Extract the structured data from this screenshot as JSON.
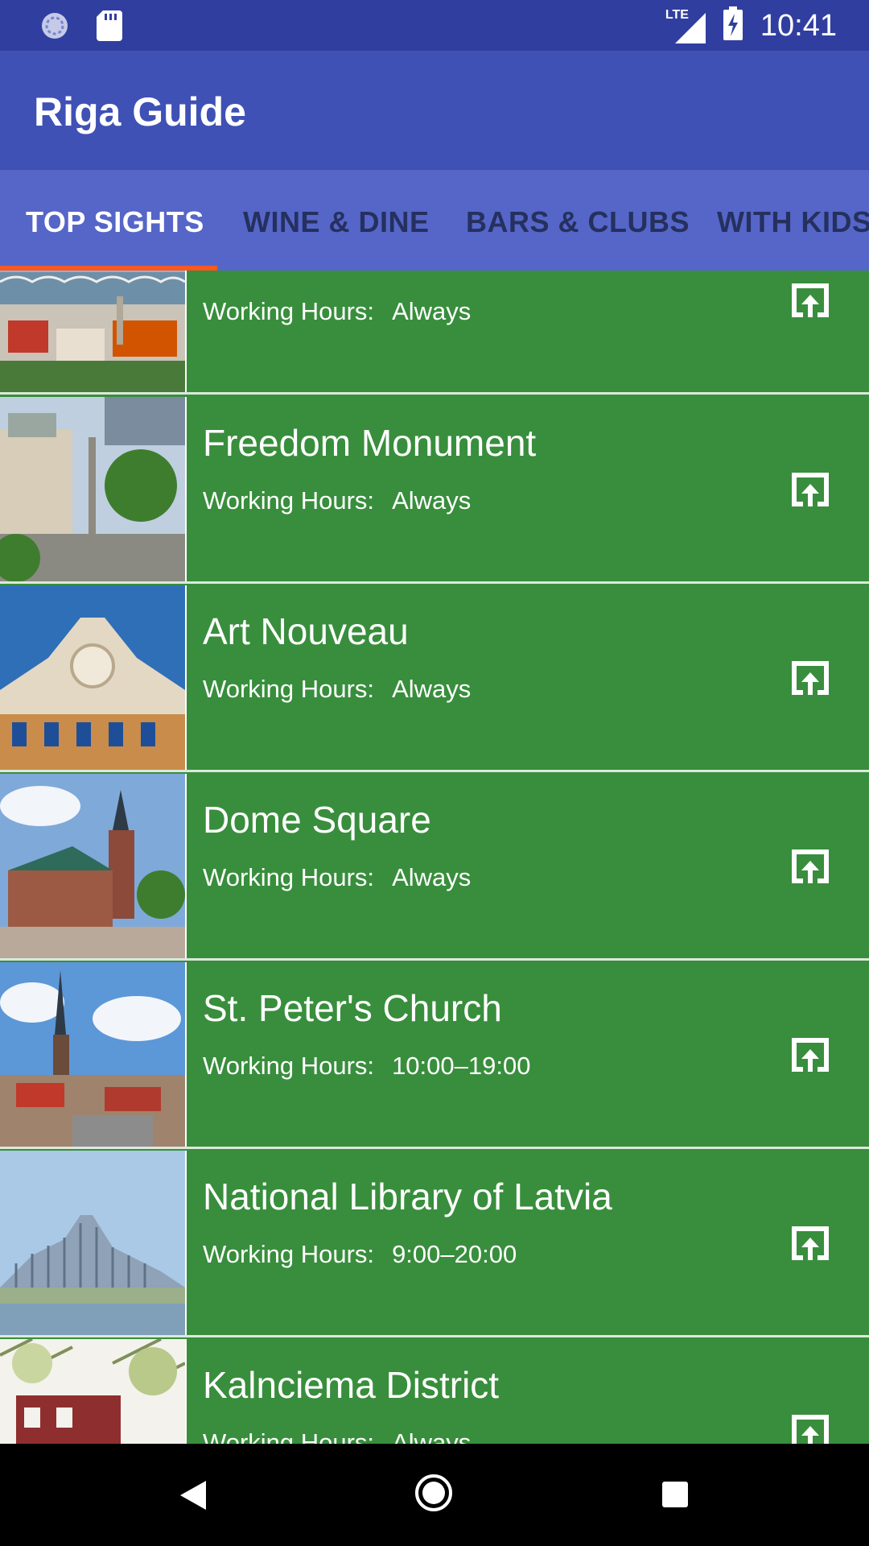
{
  "status_bar": {
    "time": "10:41",
    "network": "LTE"
  },
  "app": {
    "title": "Riga Guide"
  },
  "tabs": [
    {
      "label": "TOP SIGHTS",
      "active": true
    },
    {
      "label": "WINE & DINE",
      "active": false
    },
    {
      "label": "BARS & CLUBS",
      "active": false
    },
    {
      "label": "WITH KIDS",
      "active": false
    }
  ],
  "hours_label": "Working Hours:",
  "sights": [
    {
      "title": "",
      "hours": "Always",
      "image": "riga-panorama"
    },
    {
      "title": "Freedom Monument",
      "hours": "Always",
      "image": "freedom-monument"
    },
    {
      "title": "Art Nouveau",
      "hours": "Always",
      "image": "art-nouveau-facade"
    },
    {
      "title": "Dome Square",
      "hours": "Always",
      "image": "dome-cathedral"
    },
    {
      "title": "St. Peter's Church",
      "hours": "10:00–19:00",
      "image": "st-peters-spire"
    },
    {
      "title": "National Library of Latvia",
      "hours": "9:00–20:00",
      "image": "national-library"
    },
    {
      "title": "Kalnciema District",
      "hours": "Always",
      "image": "kalnciema-house"
    }
  ],
  "colors": {
    "status_bar": "#303F9F",
    "app_bar": "#3F51B5",
    "tab_bar": "#5566C8",
    "tab_indicator": "#FF5722",
    "list_item": "#388E3C"
  },
  "icons": {
    "share": "open-in-new-icon",
    "nav_back": "back-triangle-icon",
    "nav_home": "home-circle-icon",
    "nav_recents": "recents-square-icon"
  }
}
